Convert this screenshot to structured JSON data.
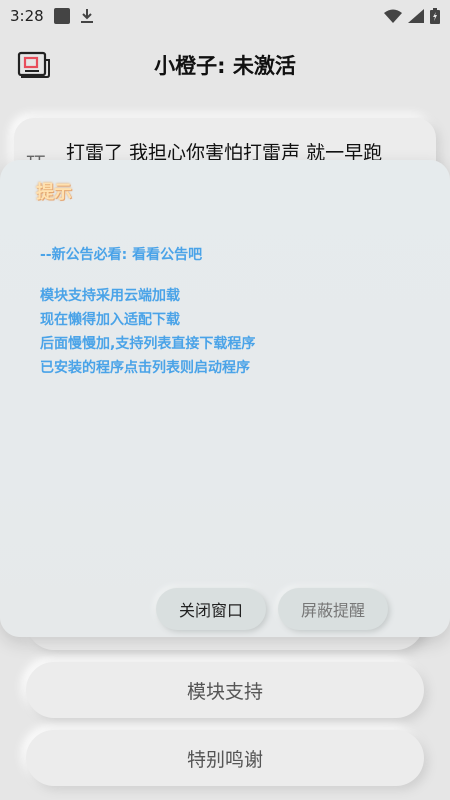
{
  "status_bar": {
    "time": "3:28"
  },
  "header": {
    "title": "小橙子: 未激活"
  },
  "announcement": {
    "prefix": "珏",
    "text": "打雷了 我担心你害怕打雷声 就一早跑"
  },
  "dialog": {
    "title": "提示",
    "notice_head": "--新公告必看: 看看公告吧",
    "lines": [
      "模块支持采用云端加载",
      "现在懒得加入适配下载",
      "后面慢慢加,支持列表直接下载程序",
      "已安装的程序点击列表则启动程序"
    ],
    "close_label": "关闭窗口",
    "mute_label": "屏蔽提醒"
  },
  "buttons": {
    "module_support": "模块支持",
    "special_thanks": "特别鸣谢"
  },
  "colors": {
    "notice_text": "#4aa3e8",
    "background": "#e6e6e6"
  }
}
